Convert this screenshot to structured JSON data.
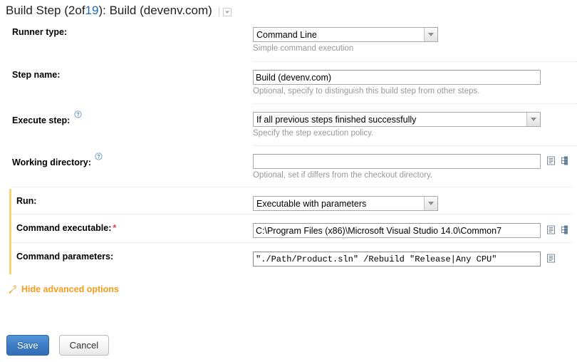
{
  "header": {
    "prefix": "Build Step (",
    "current": "2",
    "mid": " of ",
    "total": "19",
    "suffix": "): Build (devenv.com)",
    "caret_icon": "chevron-down-icon"
  },
  "form": {
    "runner_type": {
      "label": "Runner type:",
      "value": "Command Line",
      "hint": "Simple command execution"
    },
    "step_name": {
      "label": "Step name:",
      "value": "Build (devenv.com)",
      "hint": "Optional, specify to distinguish this build step from other steps."
    },
    "execute_step": {
      "label": "Execute step:",
      "help_icon": "help-circle-icon",
      "value": "If all previous steps finished successfully",
      "hint": "Specify the step execution policy."
    },
    "working_directory": {
      "label": "Working directory:",
      "help_icon": "help-circle-icon",
      "value": "",
      "placeholder": "",
      "hint": "Optional, set if differs from the checkout directory.",
      "icons": [
        "document-lines-icon",
        "tree-browse-icon"
      ]
    },
    "run": {
      "label": "Run:",
      "value": "Executable with parameters"
    },
    "command_executable": {
      "label": "Command executable:",
      "required_marker": "*",
      "value": "C:\\Program Files (x86)\\Microsoft Visual Studio 14.0\\Common7",
      "icons": [
        "document-lines-icon",
        "tree-browse-icon"
      ]
    },
    "command_parameters": {
      "label": "Command parameters:",
      "value": "\"./Path/Product.sln\" /Rebuild \"Release|Any CPU\"",
      "icons": [
        "document-lines-icon"
      ]
    }
  },
  "advanced_toggle": {
    "icon": "wrench-icon",
    "label": "Hide advanced options"
  },
  "buttons": {
    "save": "Save",
    "cancel": "Cancel"
  },
  "colors": {
    "accent_blue": "#1a6bb5",
    "advanced_bar": "#f5d372",
    "advanced_link": "#f59b1b",
    "required": "#d24444",
    "hint": "#999999"
  }
}
